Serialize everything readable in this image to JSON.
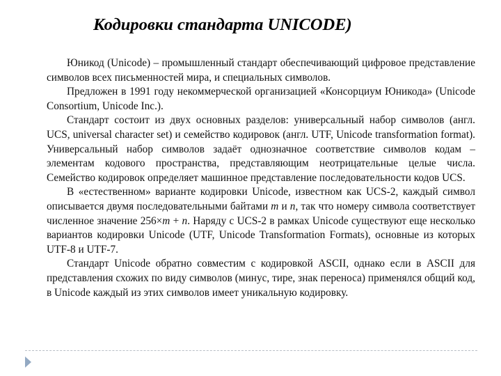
{
  "slide": {
    "title": "Кодировки стандарта UNICODE)",
    "paragraphs": [
      {
        "text": "Юникод (Unicode) – промышленный стандарт обеспечивающий цифровое представление символов всех письменностей мира, и специальных символов."
      },
      {
        "text": "Предложен в 1991 году некоммерческой организацией «Консорциум Юникода» (Unicode Consortium, Unicode Inc.)."
      },
      {
        "text": "Стандарт состоит из двух основных разделов: универсальный набор символов (англ. UCS, universal character set) и семейство кодировок (англ. UTF, Unicode transformation format). Универсальный набор символов задаёт однозначное соответствие символов кодам – элементам кодового пространства, представляющим неотрицательные целые числа. Семейство кодировок определяет машинное представление последовательности кодов UCS."
      },
      {
        "part1": "В «естественном» варианте кодировки Unicode, известном как UCS-2, каждый символ описывается двумя последовательными байтами ",
        "var_m": "m",
        "part2": " и ",
        "var_n": "n",
        "part3": ", так что номеру символа соответствует численное значение 256×",
        "var_m2": "m",
        "part4": " + ",
        "var_n2": "n",
        "part5": ". Наряду с UCS-2 в рамках Unicode существуют еще несколько вариантов кодировки Unicode (UTF, Unicode Transformation Formats), основные из которых UTF-8 и UTF-7."
      },
      {
        "text": "Стандарт Unicode обратно совместим с кодировкой ASCII, однако если в ASCII для представления схожих по виду символов (минус, тире, знак переноса) применялся общий код, в Unicode каждый из этих символов имеет уникальную кодировку."
      }
    ]
  },
  "footer": {
    "nav_icon": "triangle-right-icon",
    "arrow_color": "#93a9c3",
    "rule_color": "#b9bfc6"
  }
}
